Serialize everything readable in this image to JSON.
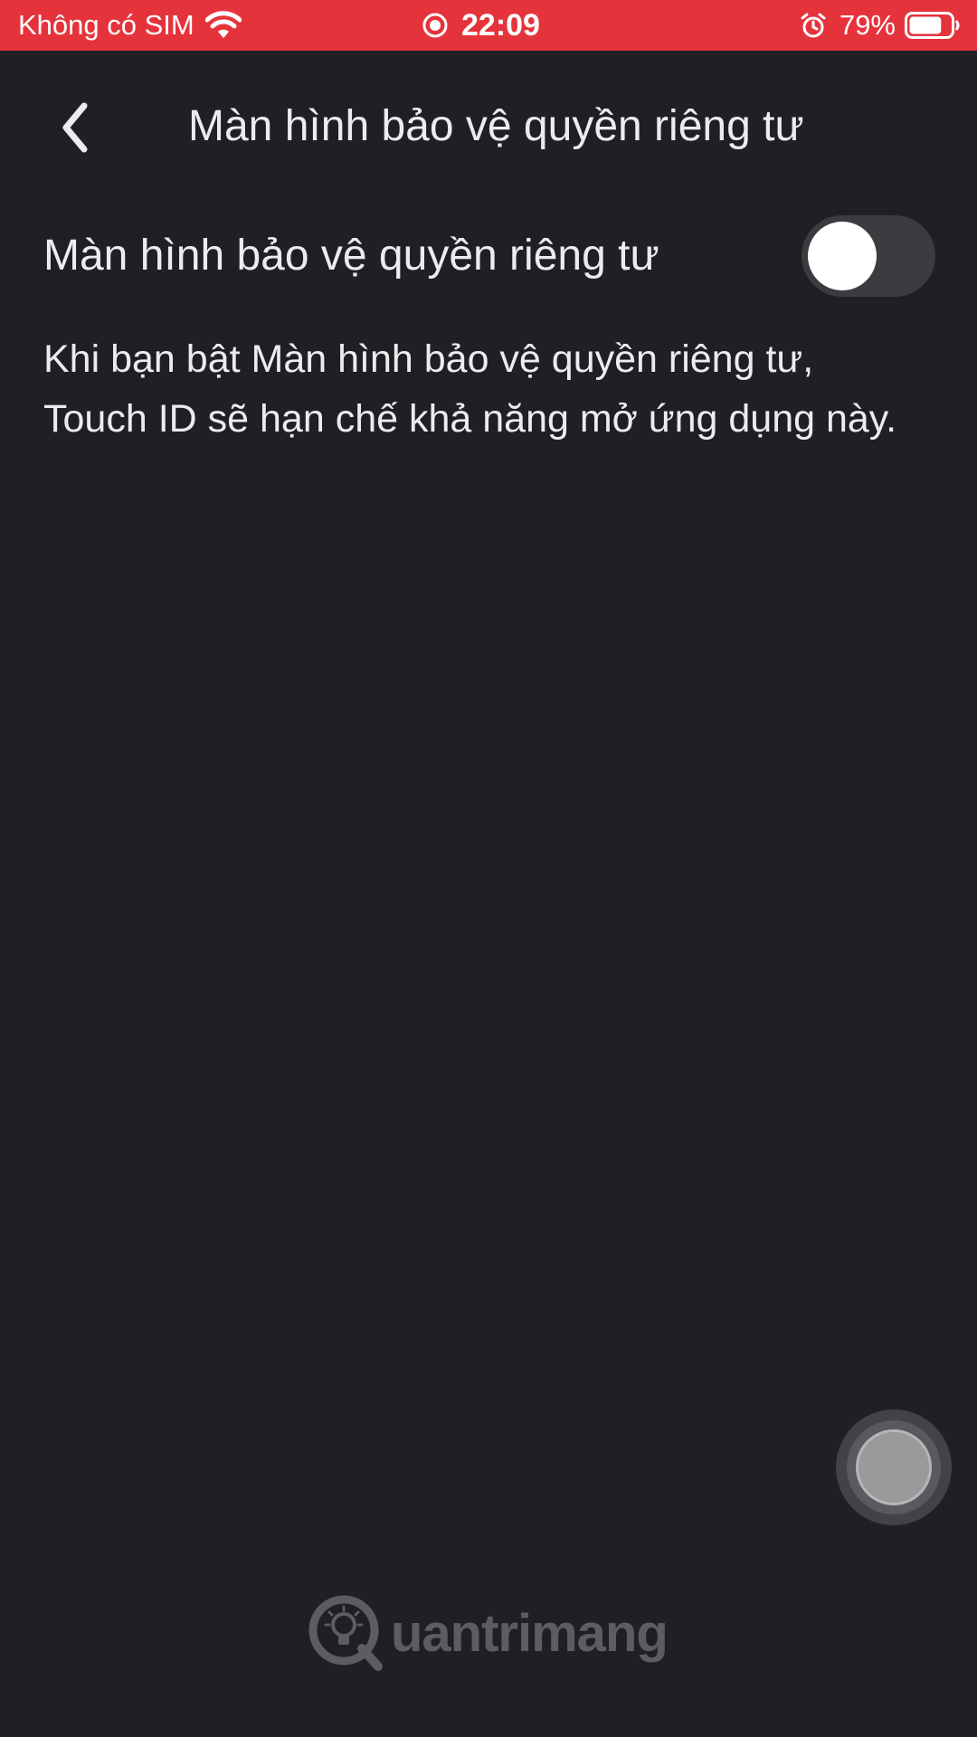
{
  "status_bar": {
    "carrier": "Không có SIM",
    "time": "22:09",
    "battery_percent": "79%",
    "battery_level": 0.79,
    "background_color": "#E5333C",
    "icons": [
      "wifi-icon",
      "screen-record-icon",
      "alarm-icon",
      "battery-icon"
    ]
  },
  "nav": {
    "back_icon": "chevron-left-icon",
    "title": "Màn hình bảo vệ quyền riêng tư"
  },
  "setting": {
    "label": "Màn hình bảo vệ quyền riêng tư",
    "toggle_on": false
  },
  "description": "Khi bạn bật Màn hình bảo vệ quyền riêng tư, Touch ID sẽ hạn chế khả năng mở ứng dụng này.",
  "watermark": {
    "brand": "uantrimang"
  },
  "colors": {
    "background": "#202024",
    "text": "#ECECEE",
    "toggle_off_track": "#3B3B40",
    "status_bar": "#E5333C"
  }
}
